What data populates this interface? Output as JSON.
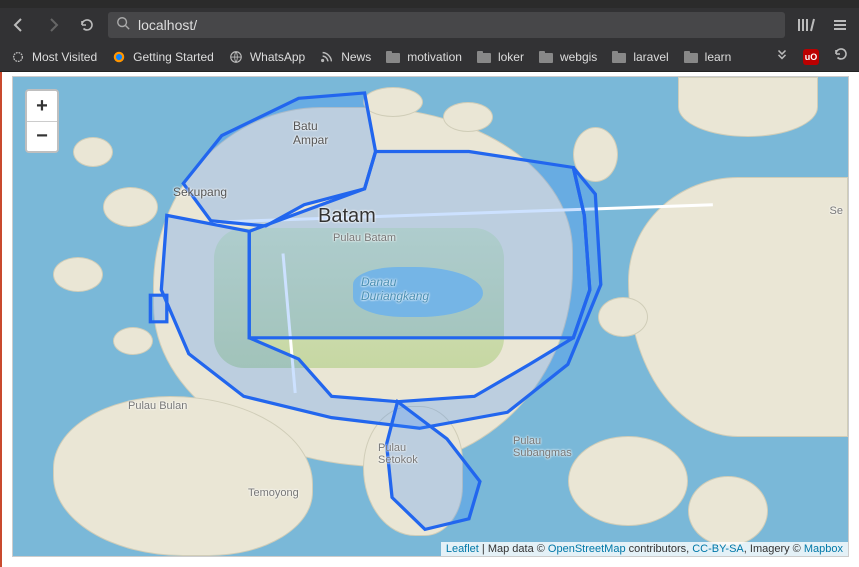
{
  "browser": {
    "url": "localhost/",
    "bookmarks": [
      {
        "label": "Most Visited",
        "icon": "star"
      },
      {
        "label": "Getting Started",
        "icon": "firefox"
      },
      {
        "label": "WhatsApp",
        "icon": "globe"
      },
      {
        "label": "News",
        "icon": "rss"
      },
      {
        "label": "motivation",
        "icon": "folder"
      },
      {
        "label": "loker",
        "icon": "folder"
      },
      {
        "label": "webgis",
        "icon": "folder"
      },
      {
        "label": "laravel",
        "icon": "folder"
      },
      {
        "label": "learn",
        "icon": "folder"
      }
    ],
    "ext_badge": "uO"
  },
  "map": {
    "zoom_in": "+",
    "zoom_out": "−",
    "places": {
      "batam": "Batam",
      "batu_ampar": "Batu\nAmpar",
      "sekupang": "Sekupang",
      "pulau_batam": "Pulau Batam",
      "danau": "Danau\nDuriangkang",
      "pulau_bulan": "Pulau Bulan",
      "temoyong": "Temoyong",
      "pulau_setokok": "Pulau\nSetokok",
      "pulau_subangmas": "Pulau\nSubangmas",
      "se": "Se"
    },
    "attribution": {
      "leaflet": "Leaflet",
      "sep1": " | Map data © ",
      "osm": "OpenStreetMap",
      "contrib": " contributors, ",
      "ccbysa": "CC-BY-SA",
      "imagery": ", Imagery © ",
      "mapbox": "Mapbox"
    }
  }
}
